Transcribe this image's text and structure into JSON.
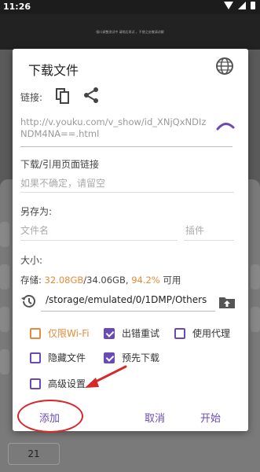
{
  "status_bar": {
    "time": "11:26"
  },
  "background": {
    "banner_text": "接口调整测试中 请稍后再试 ，不便之处敬请谅解",
    "number_box": "21"
  },
  "dialog": {
    "title": "下载文件",
    "link_label": "链接:",
    "url": "http://v.youku.com/v_show/id_XNjQxNDIzNDM4NA==.html",
    "referer_label": "下载/引用页面链接",
    "referer_placeholder": "如果不确定，请留空",
    "save_as_label": "另存为:",
    "filename_placeholder": "文件名",
    "plugin_placeholder": "插件",
    "size_label": "大小:",
    "storage": {
      "prefix": "存储: ",
      "free": "32.08GB",
      "total": "/34.06GB, ",
      "percent": "94.2%",
      "suffix": " 可用"
    },
    "path": "/storage/emulated/0/1DMP/Others",
    "options": {
      "wifi_only": "仅限Wi-Fi",
      "retry_on_error": "出错重试",
      "use_proxy": "使用代理",
      "hide_file": "隐藏文件",
      "pre_download": "预先下载",
      "advanced": "高级设置"
    },
    "buttons": {
      "add": "添加",
      "cancel": "取消",
      "start": "开始"
    }
  },
  "colors": {
    "accent": "#6a4ab7",
    "orange": "#e58b3a",
    "annotation_red": "#d62828"
  },
  "icons": [
    "globe-icon",
    "copy-icon",
    "share-icon",
    "spinner-icon",
    "history-icon",
    "folder-upload-icon"
  ]
}
